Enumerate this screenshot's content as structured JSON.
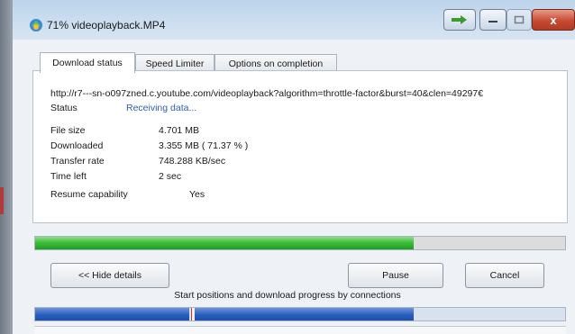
{
  "window": {
    "title": "71% videoplayback.MP4",
    "close_glyph": "x"
  },
  "tabs": [
    {
      "label": "Download status",
      "active": true
    },
    {
      "label": "Speed Limiter",
      "active": false
    },
    {
      "label": "Options on completion",
      "active": false
    }
  ],
  "status": {
    "url": "http://r7---sn-o097zned.c.youtube.com/videoplayback?algorithm=throttle-factor&burst=40&clen=49297€",
    "status_label": "Status",
    "status_value": "Receiving data...",
    "file_size_label": "File size",
    "file_size_value": "4.701  MB",
    "downloaded_label": "Downloaded",
    "downloaded_value": "3.355  MB  ( 71.37 % )",
    "transfer_rate_label": "Transfer rate",
    "transfer_rate_value": "748.288  KB/sec",
    "time_left_label": "Time left",
    "time_left_value": "2 sec",
    "resume_label": "Resume capability",
    "resume_value": "Yes"
  },
  "progress": {
    "percent": 71.37
  },
  "buttons": {
    "hide_details": "<< Hide details",
    "pause": "Pause",
    "cancel": "Cancel"
  },
  "connections": {
    "caption": "Start positions and download progress by connections",
    "segments": [
      {
        "start": 0.0,
        "end": 0.29
      },
      {
        "start": 0.3,
        "end": 0.715
      }
    ],
    "marker": 0.295
  },
  "colors": {
    "progress_fill": "#3fbe3c",
    "connection_fill": "#2a5fbf",
    "status_value": "#2f5bbf",
    "close_button": "#c54b33"
  }
}
